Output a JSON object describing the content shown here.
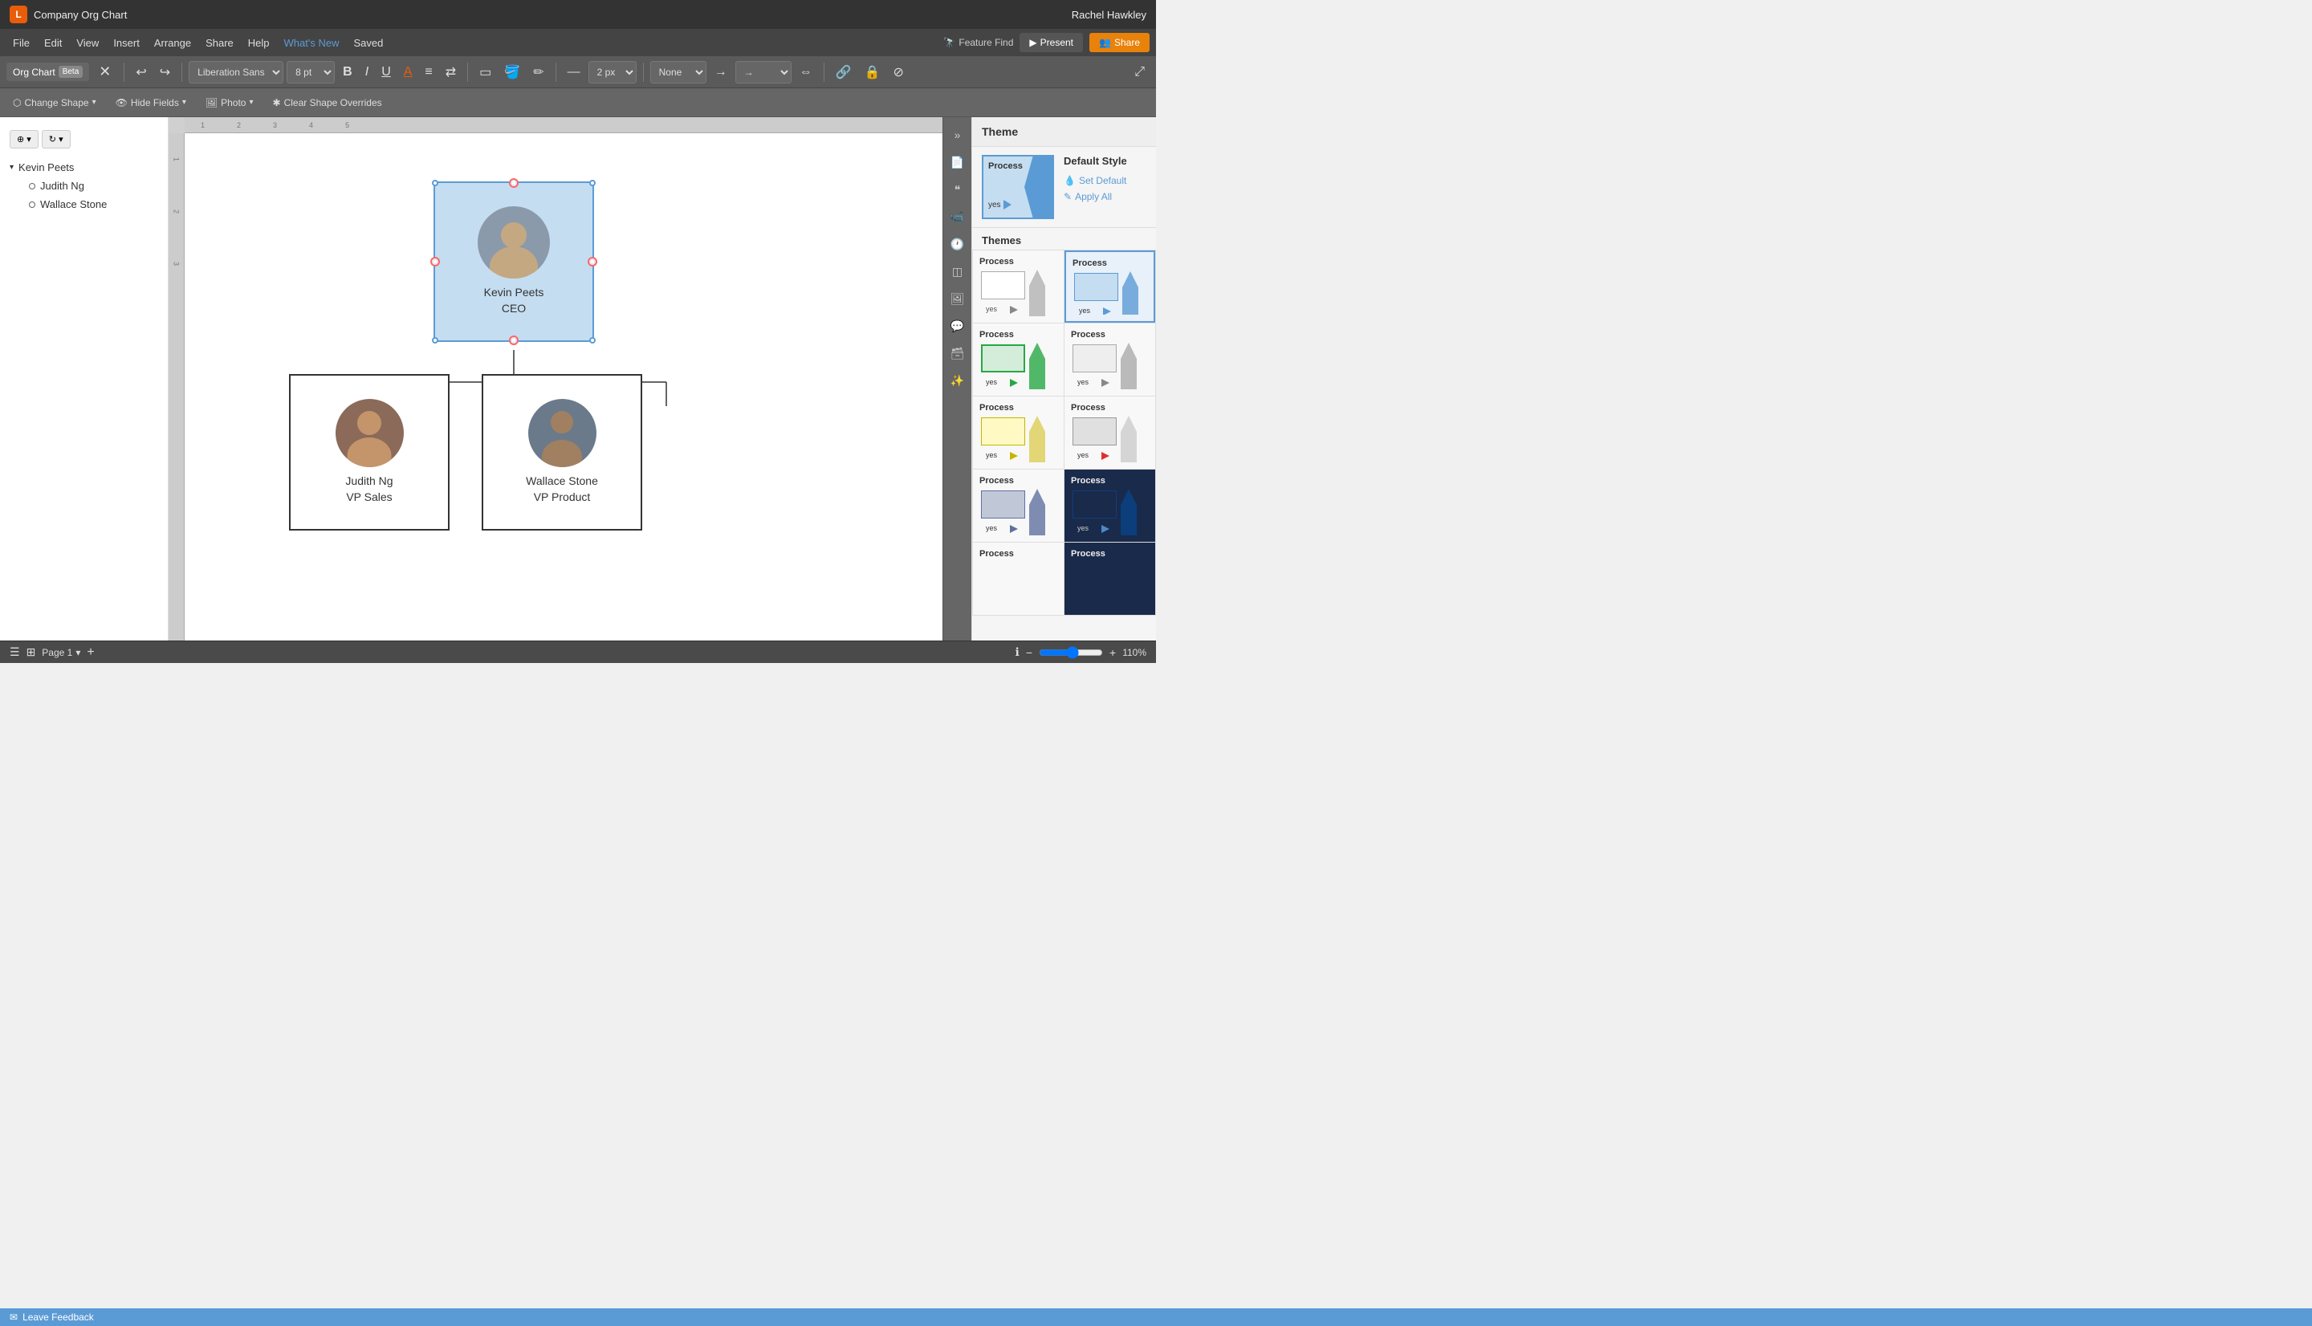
{
  "titleBar": {
    "appIcon": "L",
    "title": "Company Org Chart",
    "user": "Rachel Hawkley"
  },
  "menuBar": {
    "items": [
      "File",
      "Edit",
      "View",
      "Insert",
      "Arrange",
      "Share",
      "Help",
      "What's New",
      "Saved"
    ],
    "highlightItem": "What's New",
    "featureFind": "Feature Find",
    "btnPresent": "Present",
    "btnShare": "Share"
  },
  "toolbar": {
    "orgChartLabel": "Org Chart",
    "betaLabel": "Beta",
    "fontFamily": "Liberation Sans",
    "fontSize": "8 pt",
    "lineWidth": "2 px",
    "arrowOption": "None"
  },
  "secondaryToolbar": {
    "changeShape": "Change Shape",
    "hideFields": "Hide Fields",
    "photo": "Photo",
    "clearShapeOverrides": "Clear Shape Overrides"
  },
  "sidebar": {
    "rootItem": "Kevin Peets",
    "children": [
      "Judith Ng",
      "Wallace Stone"
    ]
  },
  "canvas": {
    "ceoNode": {
      "name": "Kevin Peets",
      "title": "CEO"
    },
    "subNodes": [
      {
        "name": "Judith Ng",
        "title": "VP Sales"
      },
      {
        "name": "Wallace Stone",
        "title": "VP Product"
      }
    ]
  },
  "themePanel": {
    "title": "Theme",
    "defaultStyleLabel": "Default Style",
    "setDefault": "Set Default",
    "applyAll": "Apply All",
    "processLabel": "Process",
    "yesLabel": "yes",
    "themesLabel": "Themes",
    "themes": [
      {
        "id": "white",
        "label": "Process",
        "color": "white"
      },
      {
        "id": "blue",
        "label": "Process",
        "color": "blue"
      },
      {
        "id": "green",
        "label": "Process",
        "color": "green"
      },
      {
        "id": "lightgray",
        "label": "Process",
        "color": "lightgray"
      },
      {
        "id": "yellow",
        "label": "Process",
        "color": "yellow"
      },
      {
        "id": "darkgray",
        "label": "Process",
        "color": "darkgray"
      },
      {
        "id": "darkblue",
        "label": "Process",
        "color": "darkblue"
      },
      {
        "id": "navy",
        "label": "Process",
        "color": "navy"
      }
    ]
  },
  "statusBar": {
    "views": [
      "list-view",
      "grid-view"
    ],
    "pageLabel": "Page 1",
    "addPage": "+",
    "zoom": "110%",
    "feedbackLabel": "Leave Feedback"
  }
}
